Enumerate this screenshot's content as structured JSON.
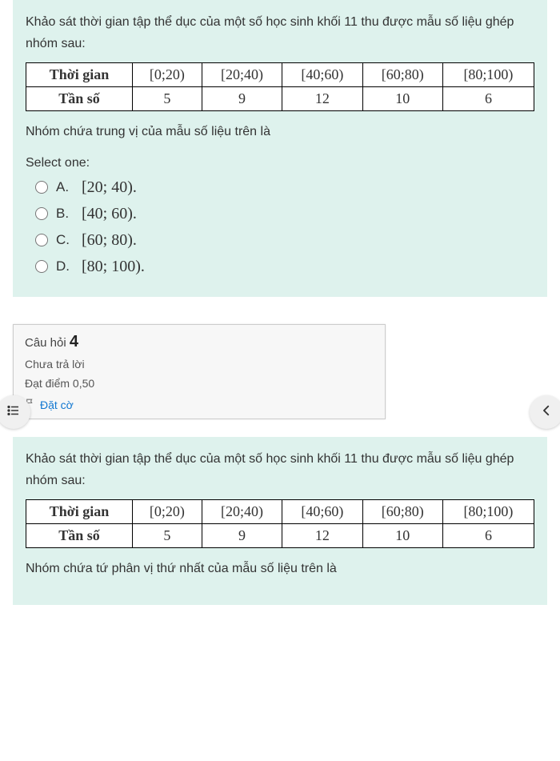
{
  "q3": {
    "prompt": "Khảo sát thời gian tập thể dục của một số học sinh khối 11 thu được mẫu số liệu ghép nhóm sau:",
    "table": {
      "row_label_1": "Thời gian",
      "row_label_2": "Tần số",
      "intervals": [
        "[0;20)",
        "[20;40)",
        "[40;60)",
        "[60;80)",
        "[80;100)"
      ],
      "freqs": [
        "5",
        "9",
        "12",
        "10",
        "6"
      ]
    },
    "after": "Nhóm chứa trung vị của mẫu số liệu trên là",
    "select_one": "Select one:",
    "options": [
      {
        "letter": "A.",
        "text": "[20; 40)."
      },
      {
        "letter": "B.",
        "text": "[40; 60)."
      },
      {
        "letter": "C.",
        "text": "[60; 80)."
      },
      {
        "letter": "D.",
        "text": "[80; 100)."
      }
    ]
  },
  "info": {
    "title_prefix": "Câu hỏi ",
    "number": "4",
    "status": "Chưa trả lời",
    "marks": "Đạt điểm 0,50",
    "flag": "Đặt cờ"
  },
  "q4": {
    "prompt": "Khảo sát thời gian tập thể dục của một số học sinh khối 11 thu được mẫu số liệu ghép nhóm sau:",
    "table": {
      "row_label_1": "Thời gian",
      "row_label_2": "Tần số",
      "intervals": [
        "[0;20)",
        "[20;40)",
        "[40;60)",
        "[60;80)",
        "[80;100)"
      ],
      "freqs": [
        "5",
        "9",
        "12",
        "10",
        "6"
      ]
    },
    "after": "Nhóm chứa tứ phân vị thứ nhất của mẫu số liệu trên là"
  },
  "icons": {
    "list": "list-icon",
    "chevron_left": "chevron-left-icon",
    "flag": "flag-icon"
  }
}
